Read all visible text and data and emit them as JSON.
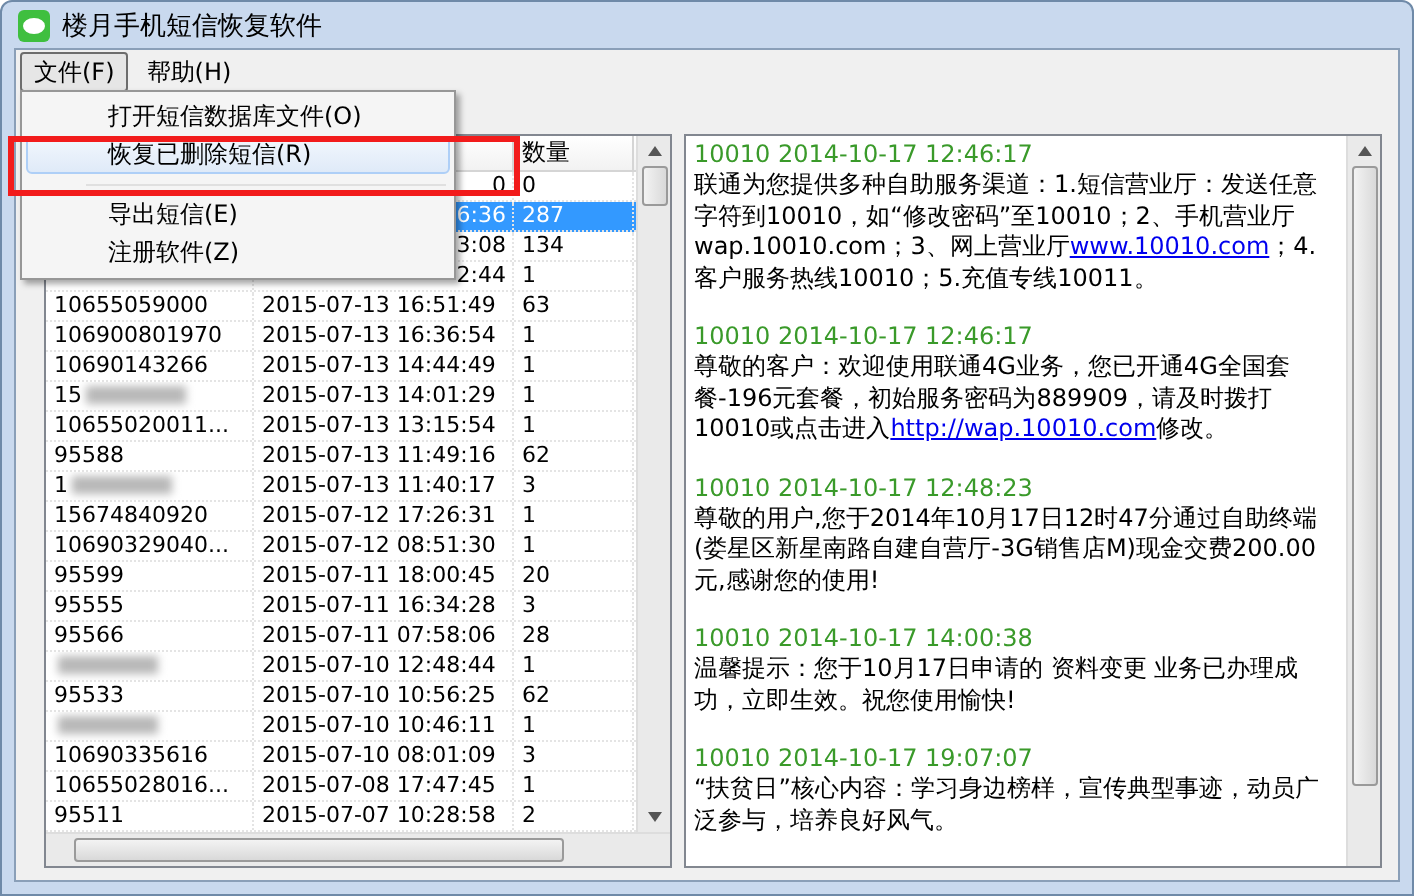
{
  "window": {
    "title": "楼月手机短信恢复软件"
  },
  "menubar": [
    {
      "label": "文件(F)",
      "selected": true
    },
    {
      "label": "帮助(H)",
      "selected": false
    }
  ],
  "file_menu": [
    {
      "kind": "item",
      "label": "打开短信数据库文件(O)",
      "selected": false
    },
    {
      "kind": "item",
      "label": "恢复已删除短信(R)",
      "selected": true
    },
    {
      "kind": "separator"
    },
    {
      "kind": "item",
      "label": "导出短信(E)",
      "selected": false
    },
    {
      "kind": "item",
      "label": "注册软件(Z)",
      "selected": false
    }
  ],
  "list": {
    "columns": [
      "数量"
    ],
    "rows": [
      {
        "time": "0",
        "count": "0",
        "selected": false,
        "covered": true,
        "blurred": false
      },
      {
        "time": "6:36",
        "count": "287",
        "selected": true,
        "covered": true,
        "blurred": false
      },
      {
        "time": "3:08",
        "count": "134",
        "selected": false,
        "covered": true,
        "blurred": false
      },
      {
        "time": "2:44",
        "count": "1",
        "selected": false,
        "covered": true,
        "blurred": false
      },
      {
        "number": "10655059000",
        "time": "2015-07-13 16:51:49",
        "count": "63",
        "selected": false,
        "covered": false,
        "blurred": false
      },
      {
        "number": "106900801970",
        "time": "2015-07-13 16:36:54",
        "count": "1",
        "selected": false,
        "covered": false,
        "blurred": false
      },
      {
        "number": "10690143266",
        "time": "2015-07-13 14:44:49",
        "count": "1",
        "selected": false,
        "covered": false,
        "blurred": false
      },
      {
        "number": "15",
        "time": "2015-07-13 14:01:29",
        "count": "1",
        "selected": false,
        "covered": false,
        "blurred": true
      },
      {
        "number": "10655020011...",
        "time": "2015-07-13 13:15:54",
        "count": "1",
        "selected": false,
        "covered": false,
        "blurred": false
      },
      {
        "number": "95588",
        "time": "2015-07-13 11:49:16",
        "count": "62",
        "selected": false,
        "covered": false,
        "blurred": false
      },
      {
        "number": "1",
        "time": "2015-07-13 11:40:17",
        "count": "3",
        "selected": false,
        "covered": false,
        "blurred": true
      },
      {
        "number": "15674840920",
        "time": "2015-07-12 17:26:31",
        "count": "1",
        "selected": false,
        "covered": false,
        "blurred": false
      },
      {
        "number": "10690329040...",
        "time": "2015-07-12 08:51:30",
        "count": "1",
        "selected": false,
        "covered": false,
        "blurred": false
      },
      {
        "number": "95599",
        "time": "2015-07-11 18:00:45",
        "count": "20",
        "selected": false,
        "covered": false,
        "blurred": false
      },
      {
        "number": "95555",
        "time": "2015-07-11 16:34:28",
        "count": "3",
        "selected": false,
        "covered": false,
        "blurred": false
      },
      {
        "number": "95566",
        "time": "2015-07-11 07:58:06",
        "count": "28",
        "selected": false,
        "covered": false,
        "blurred": false
      },
      {
        "time": "2015-07-10 12:48:44",
        "count": "1",
        "selected": false,
        "covered": false,
        "blurred": true
      },
      {
        "number": "95533",
        "time": "2015-07-10 10:56:25",
        "count": "62",
        "selected": false,
        "covered": false,
        "blurred": false
      },
      {
        "time": "2015-07-10 10:46:11",
        "count": "1",
        "selected": false,
        "covered": false,
        "blurred": true
      },
      {
        "number": "10690335616",
        "time": "2015-07-10 08:01:09",
        "count": "3",
        "selected": false,
        "covered": false,
        "blurred": false
      },
      {
        "number": "10655028016...",
        "time": "2015-07-08 17:47:45",
        "count": "1",
        "selected": false,
        "covered": false,
        "blurred": false
      },
      {
        "number": "95511",
        "time": "2015-07-07 10:28:58",
        "count": "2",
        "selected": false,
        "covered": false,
        "blurred": false
      }
    ]
  },
  "messages": [
    {
      "header": "10010 2014-10-17 12:46:17",
      "body": [
        {
          "text": "联通为您提供多种自助服务渠道：1.短信营业厅：发送任意字符到10010，如“修改密码”至10010；2、手机营业厅wap.10010.com；3、网上营业厅"
        },
        {
          "text": "www.10010.com",
          "link": true
        },
        {
          "text": "；4. 客户服务热线10010；5.充值专线10011。"
        }
      ]
    },
    {
      "header": "10010 2014-10-17 12:46:17",
      "body": [
        {
          "text": "尊敬的客户：欢迎使用联通4G业务，您已开通4G全国套餐-196元套餐，初始服务密码为889909，请及时拨打10010或点击进入"
        },
        {
          "text": "http://wap.10010.com",
          "link": true
        },
        {
          "text": "修改。"
        }
      ]
    },
    {
      "header": "10010 2014-10-17 12:48:23",
      "body": [
        {
          "text": "尊敬的用户,您于2014年10月17日12时47分通过自助终端(娄星区新星南路自建自营厅-3G销售店M)现金交费200.00元,感谢您的使用!"
        }
      ]
    },
    {
      "header": "10010 2014-10-17 14:00:38",
      "body": [
        {
          "text": "温馨提示：您于10月17日申请的 资料变更 业务已办理成功，立即生效。祝您使用愉快!"
        }
      ]
    },
    {
      "header": "10010 2014-10-17 19:07:07",
      "body": [
        {
          "text": "“扶贫日”核心内容：学习身边榜样，宣传典型事迹，动员广泛参与，培养良好风气。"
        }
      ]
    }
  ]
}
